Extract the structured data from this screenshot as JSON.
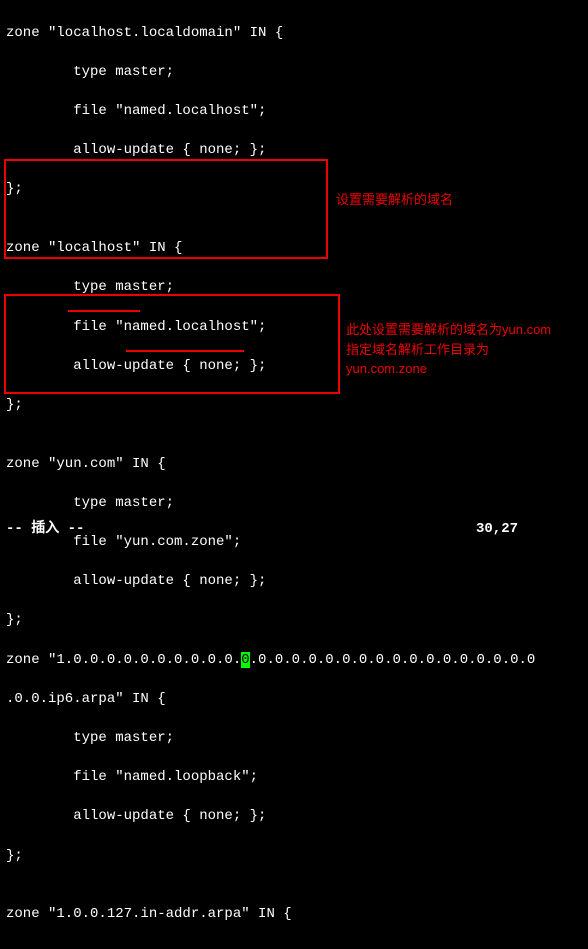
{
  "code": {
    "l0": "zone \"localhost.localdomain\" IN {",
    "l1": "        type master;",
    "l2": "        file \"named.localhost\";",
    "l3": "        allow-update { none; };",
    "l4": "};",
    "l5": "",
    "l6": "zone \"localhost\" IN {",
    "l7": "        type master;",
    "l8": "        file \"named.localhost\";",
    "l9": "        allow-update { none; };",
    "l10": "};",
    "l11": "",
    "l12": "zone \"yun.com\" IN {",
    "l13": "        type master;",
    "l14": "        file \"yun.com.zone\";",
    "l15": "        allow-update { none; };",
    "l16": "};",
    "l17a": "zone \"1.0.0.0.0.0.0.0.0.0.0.",
    "l17b": "0",
    "l17c": ".0.0.0.0.0.0.0.0.0.0.0.0.0.0.0.0.0",
    "l18": ".0.0.ip6.arpa\" IN {",
    "l19": "        type master;",
    "l20": "        file \"named.loopback\";",
    "l21": "        allow-update { none; };",
    "l22": "};",
    "l23": "",
    "l24": "zone \"1.0.0.127.in-addr.arpa\" IN {"
  },
  "annotations": {
    "a1": "设置需要解析的域名",
    "a2_l1": "此处设置需要解析的域名为yun.com",
    "a2_l2": "指定域名解析工作目录为",
    "a2_l3": "yun.com.zone"
  },
  "status": {
    "mode": "-- 插入 --",
    "position": "30,27"
  }
}
